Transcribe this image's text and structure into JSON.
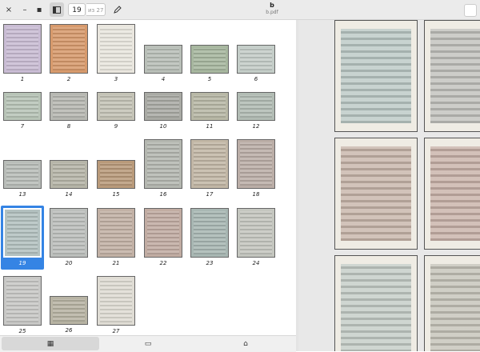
{
  "header": {
    "close_label": "×",
    "minimize_label": "–",
    "maximize_label": "▪",
    "page_value": "19",
    "page_total": "из 27",
    "title": "b",
    "subtitle": "b.pdf"
  },
  "sidebar": {
    "pages": [
      {
        "label": "1",
        "color": "#c9bcd4"
      },
      {
        "label": "2",
        "color": "#d79a6c"
      },
      {
        "label": "3",
        "color": "#e9e6de"
      },
      {
        "label": "4",
        "color": "#b9bfb8"
      },
      {
        "label": "5",
        "color": "#a7b79f"
      },
      {
        "label": "6",
        "color": "#c4cdc8"
      },
      {
        "label": "7",
        "color": "#b8c4b7"
      },
      {
        "label": "8",
        "color": "#b7b8b2"
      },
      {
        "label": "9",
        "color": "#c4c3b6"
      },
      {
        "label": "10",
        "color": "#a9aaa4"
      },
      {
        "label": "11",
        "color": "#b8b8a6"
      },
      {
        "label": "12",
        "color": "#b2bcb4"
      },
      {
        "label": "13",
        "color": "#b9bdb9"
      },
      {
        "label": "14",
        "color": "#b6b5a8"
      },
      {
        "label": "15",
        "color": "#b99a7a"
      },
      {
        "label": "16",
        "color": "#b4b7b0"
      },
      {
        "label": "17",
        "color": "#c2b7a6"
      },
      {
        "label": "18",
        "color": "#bbaea7"
      },
      {
        "label": "19",
        "color": "#b3c1c0"
      },
      {
        "label": "20",
        "color": "#bcbfbc"
      },
      {
        "label": "21",
        "color": "#c2b1a5"
      },
      {
        "label": "22",
        "color": "#c1aca2"
      },
      {
        "label": "23",
        "color": "#a8b7b3"
      },
      {
        "label": "24",
        "color": "#c4c6bf"
      },
      {
        "label": "25",
        "color": "#c8c8c6"
      },
      {
        "label": "26",
        "color": "#b7b3a3"
      },
      {
        "label": "27",
        "color": "#dfdcd4"
      }
    ],
    "selected_page": "19"
  },
  "tabs": [
    {
      "name": "thumbnails",
      "icon": "grid-icon",
      "glyph": "▦"
    },
    {
      "name": "annotations",
      "icon": "comment-icon",
      "glyph": "▭"
    },
    {
      "name": "bookmarks",
      "icon": "bookmark-icon",
      "glyph": "⌂"
    }
  ],
  "main": {
    "pages": [
      {
        "color": "#bcc9c6"
      },
      {
        "color": "#c2c2bd"
      },
      {
        "color": "#c8b6ab"
      },
      {
        "color": "#c9b3aa"
      },
      {
        "color": "#c5cdc7"
      },
      {
        "color": "#c6c4b9"
      }
    ]
  }
}
